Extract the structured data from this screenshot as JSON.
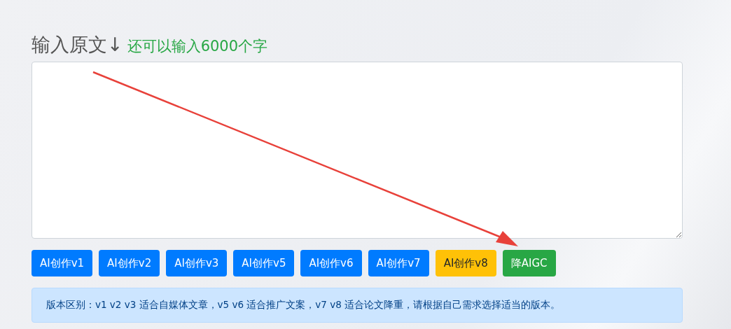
{
  "heading": {
    "title": "输入原文↓",
    "hint": "还可以输入6000个字"
  },
  "buttons": [
    {
      "label": "AI创作v1",
      "kind": "primary"
    },
    {
      "label": "AI创作v2",
      "kind": "primary"
    },
    {
      "label": "AI创作v3",
      "kind": "primary"
    },
    {
      "label": "AI创作v5",
      "kind": "primary"
    },
    {
      "label": "AI创作v6",
      "kind": "primary"
    },
    {
      "label": "AI创作v7",
      "kind": "primary"
    },
    {
      "label": "AI创作v8",
      "kind": "warning"
    },
    {
      "label": "降AIGC",
      "kind": "success"
    }
  ],
  "notice": "版本区别：v1 v2 v3 适合自媒体文章，v5 v6 适合推广文案，v7 v8 适合论文降重，请根据自己需求选择适当的版本。"
}
